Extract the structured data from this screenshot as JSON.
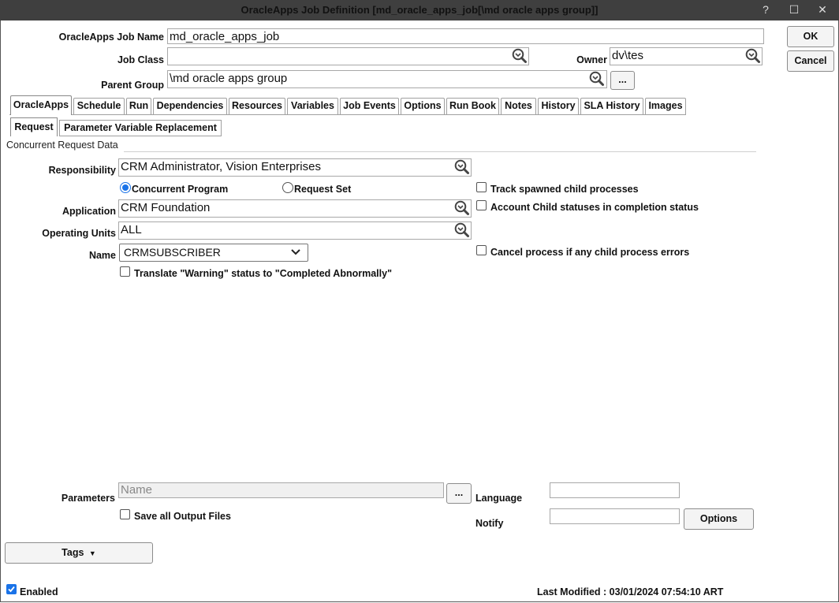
{
  "window": {
    "title": "OracleApps Job Definition [md_oracle_apps_job[\\md oracle apps group]]",
    "help_glyph": "?",
    "maximize_glyph": "☐",
    "close_glyph": "✕"
  },
  "header": {
    "job_name_label": "OracleApps Job Name",
    "job_name_value": "md_oracle_apps_job",
    "job_class_label": "Job Class",
    "job_class_value": "",
    "owner_label": "Owner",
    "owner_value": "dv\\tes",
    "parent_group_label": "Parent Group",
    "parent_group_value": "\\md oracle apps group",
    "browse_label": "...",
    "ok_label": "OK",
    "cancel_label": "Cancel"
  },
  "tabs": [
    {
      "label": "OracleApps",
      "active": true
    },
    {
      "label": "Schedule"
    },
    {
      "label": "Run"
    },
    {
      "label": "Dependencies"
    },
    {
      "label": "Resources"
    },
    {
      "label": "Variables"
    },
    {
      "label": "Job Events"
    },
    {
      "label": "Options"
    },
    {
      "label": "Run Book"
    },
    {
      "label": "Notes"
    },
    {
      "label": "History"
    },
    {
      "label": "SLA History"
    },
    {
      "label": "Images"
    }
  ],
  "subtabs": [
    {
      "label": "Request",
      "active": true
    },
    {
      "label": "Parameter Variable Replacement"
    }
  ],
  "section": {
    "title": "Concurrent Request Data"
  },
  "request": {
    "responsibility_label": "Responsibility",
    "responsibility_value": "CRM Administrator, Vision Enterprises",
    "radio_concurrent_label": "Concurrent Program",
    "radio_concurrent_checked": true,
    "radio_request_set_label": "Request Set",
    "radio_request_set_checked": false,
    "application_label": "Application",
    "application_value": "CRM Foundation",
    "operating_units_label": "Operating Units",
    "operating_units_value": "ALL",
    "name_label": "Name",
    "name_value": "CRMSUBSCRIBER",
    "translate_warning_label": "Translate \"Warning\" status to \"Completed Abnormally\"",
    "translate_warning_checked": false,
    "track_spawned_label": "Track spawned child processes",
    "track_spawned_checked": false,
    "account_child_label": "Account Child statuses in completion status",
    "account_child_checked": false,
    "cancel_process_label": "Cancel process if any child process errors",
    "cancel_process_checked": false
  },
  "bottom": {
    "parameters_label": "Parameters",
    "parameters_placeholder": "Name",
    "parameters_browse": "...",
    "save_output_label": "Save all Output Files",
    "save_output_checked": false,
    "language_label": "Language",
    "language_value": "",
    "notify_label": "Notify",
    "notify_value": "",
    "options_label": "Options"
  },
  "footer": {
    "tags_label": "Tags",
    "enabled_label": "Enabled",
    "enabled_checked": true,
    "last_modified": "Last Modified : 03/01/2024 07:54:10 ART"
  },
  "colors": {
    "titlebar": "#3f3f3f",
    "accent": "#1a73e8"
  }
}
